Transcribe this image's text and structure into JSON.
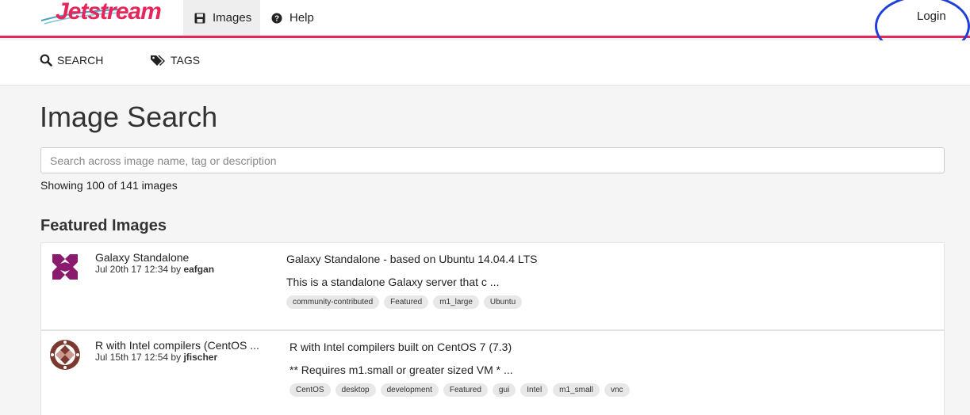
{
  "app": {
    "logo_text": "Jetstream",
    "accent_color": "#e6255a"
  },
  "nav": {
    "images_label": "Images",
    "help_label": "Help",
    "login_label": "Login"
  },
  "subnav": {
    "search_label": "SEARCH",
    "tags_label": "TAGS"
  },
  "main": {
    "title": "Image Search",
    "search_placeholder": "Search across image name, tag or description",
    "search_value": "",
    "showing_text": "Showing 100 of 141 images",
    "section_title": "Featured Images"
  },
  "images": [
    {
      "name": "Galaxy Standalone",
      "date": "Jul 20th 17 12:34 by",
      "author": "eafgan",
      "title": "Galaxy Standalone - based on Ubuntu 14.04.4 LTS",
      "description": "This is a standalone Galaxy server that c ...",
      "tags": [
        "community-contributed",
        "Featured",
        "m1_large",
        "Ubuntu"
      ],
      "avatar_color": "#8a1a6e"
    },
    {
      "name": "R with Intel compilers (CentOS ...",
      "date": "Jul 15th 17 12:54 by",
      "author": "jfischer",
      "title": "R with Intel compilers built on CentOS 7 (7.3)",
      "description": "** Requires m1.small or greater sized VM * ...",
      "tags": [
        "CentOS",
        "desktop",
        "development",
        "Featured",
        "gui",
        "Intel",
        "m1_small",
        "vnc"
      ],
      "avatar_color": "#7b3a2e"
    }
  ]
}
